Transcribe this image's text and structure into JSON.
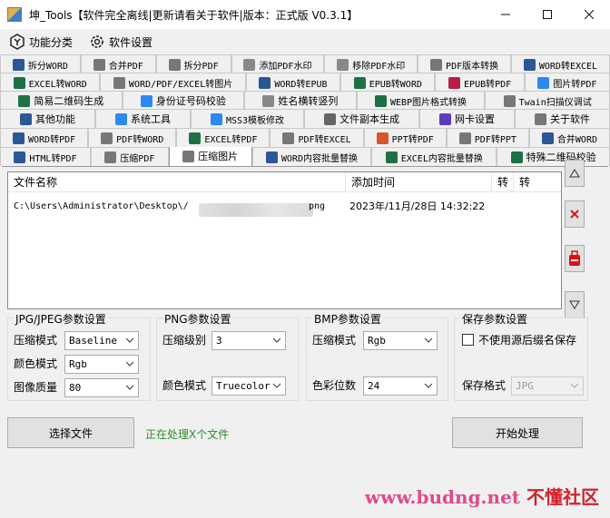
{
  "window": {
    "title": "坤_Tools【软件完全离线|更新请看关于软件|版本：正式版 V0.3.1】"
  },
  "menu": [
    {
      "label": "功能分类",
      "icon": "function-category-icon"
    },
    {
      "label": "软件设置",
      "icon": "settings-gear-icon"
    }
  ],
  "tab_rows": [
    [
      {
        "label": "拆分WORD",
        "color": "#2b5797"
      },
      {
        "label": "合并PDF",
        "color": "#777777"
      },
      {
        "label": "拆分PDF",
        "color": "#777777"
      },
      {
        "label": "添加PDF水印",
        "color": "#888888"
      },
      {
        "label": "移除PDF水印",
        "color": "#888888"
      },
      {
        "label": "PDF版本转换",
        "color": "#777777"
      },
      {
        "label": "WORD转EXCEL",
        "color": "#2b5797"
      }
    ],
    [
      {
        "label": "EXCEL转WORD",
        "color": "#1e7145"
      },
      {
        "label": "WORD/PDF/EXCEL转图片",
        "color": "#777777"
      },
      {
        "label": "WORD转EPUB",
        "color": "#2b5797"
      },
      {
        "label": "EPUB转WORD",
        "color": "#1e7145"
      },
      {
        "label": "EPUB转PDF",
        "color": "#b91d47"
      },
      {
        "label": "图片转PDF",
        "color": "#2d89ef"
      }
    ],
    [
      {
        "label": "简易二维码生成",
        "color": "#1e7145"
      },
      {
        "label": "身份证号码校验",
        "color": "#2d89ef"
      },
      {
        "label": "姓名横转竖列",
        "color": "#888888"
      },
      {
        "label": "WEBP图片格式转换",
        "color": "#1e7145"
      },
      {
        "label": "Twain扫描仪调试",
        "color": "#777777"
      }
    ],
    [
      {
        "label": "其他功能",
        "color": "#2b5797"
      },
      {
        "label": "系统工具",
        "color": "#2d89ef"
      },
      {
        "label": "MSS3模板修改",
        "color": "#2d89ef"
      },
      {
        "label": "文件副本生成",
        "color": "#666666"
      },
      {
        "label": "网卡设置",
        "color": "#603cba"
      },
      {
        "label": "关于软件",
        "color": "#777777"
      }
    ],
    [
      {
        "label": "WORD转PDF",
        "color": "#2b5797"
      },
      {
        "label": "PDF转WORD",
        "color": "#777777"
      },
      {
        "label": "EXCEL转PDF",
        "color": "#1e7145"
      },
      {
        "label": "PDF转EXCEL",
        "color": "#777777"
      },
      {
        "label": "PPT转PDF",
        "color": "#da532c"
      },
      {
        "label": "PDF转PPT",
        "color": "#777777"
      },
      {
        "label": "合并WORD",
        "color": "#2b5797"
      }
    ],
    [
      {
        "label": "HTML转PDF",
        "color": "#2b5797"
      },
      {
        "label": "压缩PDF",
        "color": "#777777"
      },
      {
        "label": "压缩图片",
        "color": "#777777",
        "active": true
      },
      {
        "label": "WORD内容批量替换",
        "color": "#2b5797"
      },
      {
        "label": "EXCEL内容批量替换",
        "color": "#1e7145"
      },
      {
        "label": "特殊二维码校验",
        "color": "#1e7145"
      }
    ]
  ],
  "file_list": {
    "headers": [
      "文件名称",
      "添加时间",
      "转",
      "转"
    ],
    "rows": [
      {
        "path_prefix": "C:\\Users\\Administrator\\Desktop\\/",
        "path_suffix": "png",
        "added": "2023年/11月/28日 14:32:22"
      }
    ]
  },
  "side_buttons": [
    {
      "icon": "move-up-icon"
    },
    {
      "icon": "remove-icon"
    },
    {
      "icon": "clear-all-icon"
    },
    {
      "icon": "move-down-icon"
    }
  ],
  "jpg_group": {
    "title": "JPG/JPEG参数设置",
    "compress_label": "压缩模式",
    "compress_value": "Baseline",
    "color_label": "颜色模式",
    "color_value": "Rgb",
    "quality_label": "图像质量",
    "quality_value": "80"
  },
  "png_group": {
    "title": "PNG参数设置",
    "level_label": "压缩级别",
    "level_value": "3",
    "color_label": "颜色模式",
    "color_value": "Truecolor"
  },
  "bmp_group": {
    "title": "BMP参数设置",
    "compress_label": "压缩模式",
    "compress_value": "Rgb",
    "depth_label": "色彩位数",
    "depth_value": "24"
  },
  "save_group": {
    "title": "保存参数设置",
    "checkbox_label": "不使用源后缀名保存",
    "checkbox_checked": false,
    "format_label": "保存格式",
    "format_value": "JPG"
  },
  "actions": {
    "select_file": "选择文件",
    "status": "正在处理X个文件",
    "start": "开始处理"
  },
  "watermark": {
    "site": "www.budng.net",
    "brand": "不懂社区"
  }
}
